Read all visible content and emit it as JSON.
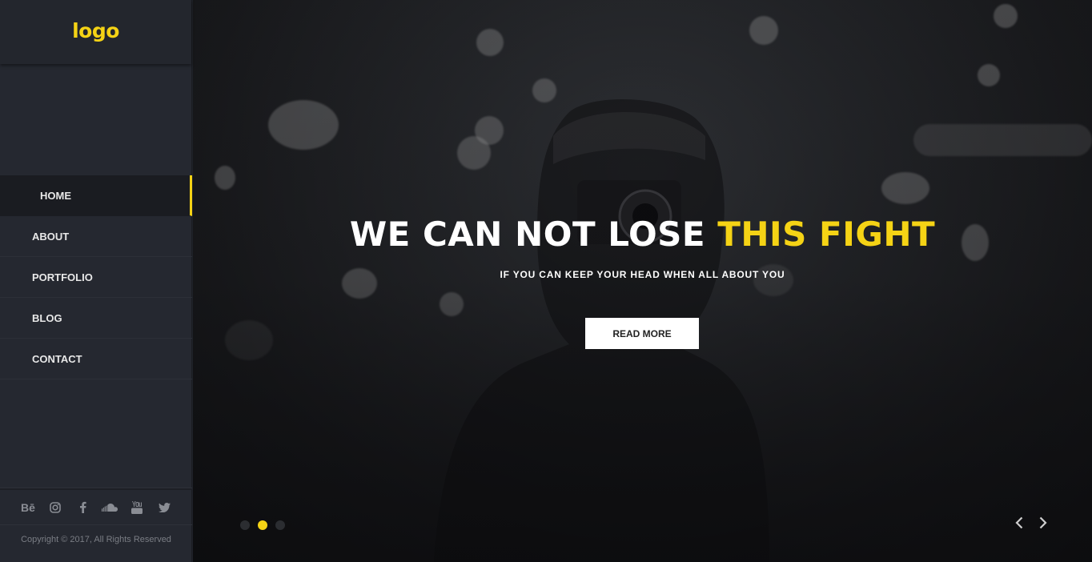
{
  "brand": {
    "logo": "logo",
    "accent_color": "#f5d315"
  },
  "nav": {
    "items": [
      {
        "label": "HOME",
        "active": true
      },
      {
        "label": "ABOUT",
        "active": false
      },
      {
        "label": "PORTFOLIO",
        "active": false
      },
      {
        "label": "BLOG",
        "active": false
      },
      {
        "label": "CONTACT",
        "active": false
      }
    ]
  },
  "footer": {
    "social_icons": [
      "behance-icon",
      "instagram-icon",
      "facebook-icon",
      "soundcloud-icon",
      "youtube-icon",
      "twitter-icon"
    ],
    "behance_text": "Bē",
    "copyright": "Copyright © 2017, All Rights Reserved"
  },
  "hero": {
    "title_main": "WE CAN NOT LOSE ",
    "title_accent": "THIS FIGHT",
    "subtitle": "IF YOU CAN KEEP YOUR HEAD WHEN ALL ABOUT YOU",
    "button_label": "READ MORE",
    "slides_count": 3,
    "active_slide": 2
  }
}
